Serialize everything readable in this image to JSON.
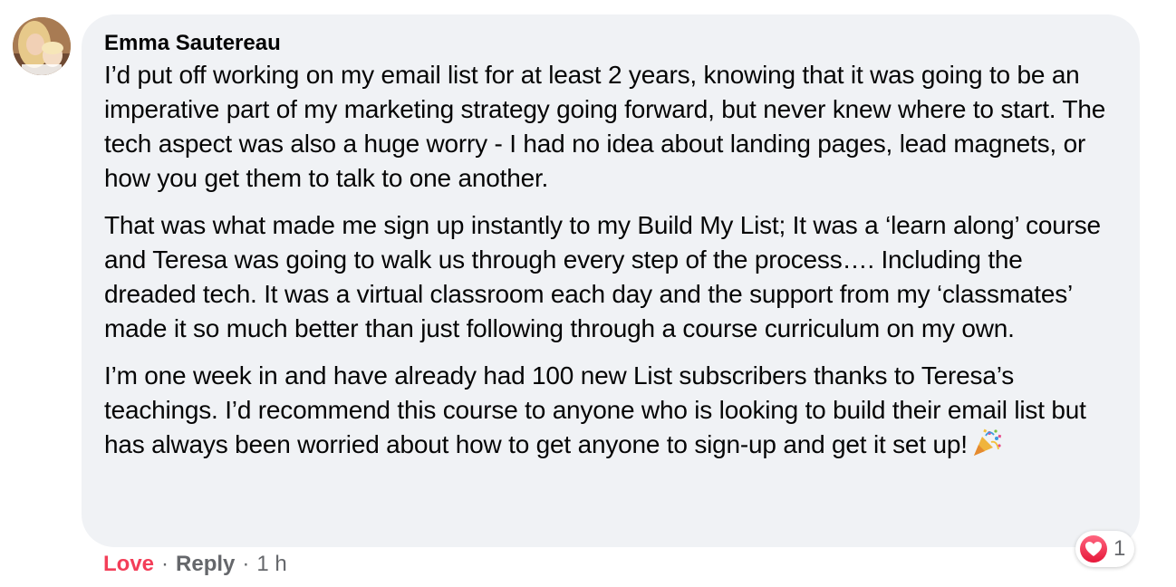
{
  "comment": {
    "author": "Emma Sautereau",
    "paragraphs": [
      "I’d put off working on my email list for at least 2 years, knowing that it was going to be an imperative part of my marketing strategy going forward, but never knew where to start. The tech aspect was also a huge worry - I had no idea about landing pages, lead magnets, or how you get them to talk to one another.",
      "That was what made me sign up instantly to my Build My List; It was a ‘learn along’ course and Teresa was going to walk us through every step of the process…. Including the dreaded tech. It was a virtual classroom each day and the support from my ‘classmates’ made it so much better than just following through a course curriculum on my own.",
      "I’m one week in and have already had 100 new List subscribers thanks to Teresa’s teachings. I’d recommend this course to anyone who is looking to build their email list but has always been worried about how to get anyone to sign-up and get it set up!"
    ],
    "trailing_icon": "party-popper-icon",
    "reactions": {
      "icon": "heart-icon",
      "count": "1"
    },
    "actions": {
      "love_label": "Love",
      "reply_label": "Reply",
      "separator": "·",
      "timestamp": "1 h"
    }
  },
  "colors": {
    "bubble_bg": "#f0f2f5",
    "text": "#050505",
    "secondary_text": "#65676b",
    "love": "#f33e58"
  }
}
